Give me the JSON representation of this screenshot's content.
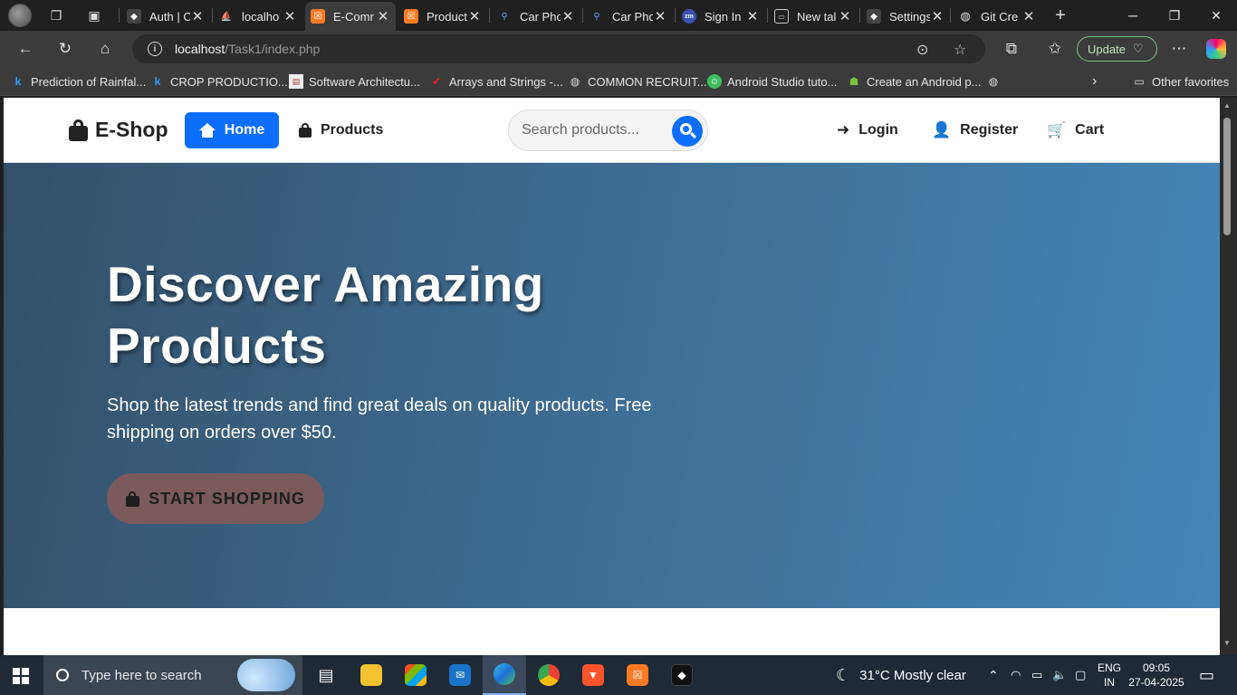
{
  "browser": {
    "tabs": [
      {
        "title": "Auth | C",
        "favicon": "dark-cube-icon",
        "active": false
      },
      {
        "title": "localho",
        "favicon": "pma-sails-icon",
        "active": false
      },
      {
        "title": "E-Comr",
        "favicon": "xampp-icon",
        "active": true
      },
      {
        "title": "Product",
        "favicon": "xampp-icon",
        "active": false
      },
      {
        "title": "Car Pho",
        "favicon": "search-icon",
        "active": false
      },
      {
        "title": "Car Pho",
        "favicon": "search-icon",
        "active": false
      },
      {
        "title": "Sign In |",
        "favicon": "zm-icon",
        "active": false
      },
      {
        "title": "New tal",
        "favicon": "newtab-icon",
        "active": false
      },
      {
        "title": "Settings",
        "favicon": "dark-cube-icon",
        "active": false
      },
      {
        "title": "Git Cre",
        "favicon": "globe-icon",
        "active": false
      }
    ],
    "url_host": "localhost",
    "url_path": "/Task1/index.php",
    "update_label": "Update",
    "favorites": [
      {
        "label": "Prediction of Rainfal...",
        "icon": "k-icon"
      },
      {
        "label": "CROP PRODUCTIO...",
        "icon": "k-icon"
      },
      {
        "label": "Software Architectu...",
        "icon": "doc-icon"
      },
      {
        "label": "Arrays and Strings -...",
        "icon": "red-bird-icon"
      },
      {
        "label": "COMMON RECRUIT...",
        "icon": "globe-icon"
      },
      {
        "label": "Android Studio tuto...",
        "icon": "android-round-icon"
      },
      {
        "label": "Create an Android p...",
        "icon": "android-icon"
      }
    ],
    "other_favorites": "Other favorites"
  },
  "site": {
    "brand": "E-Shop",
    "nav": {
      "home": "Home",
      "products": "Products",
      "login": "Login",
      "register": "Register",
      "cart": "Cart"
    },
    "search": {
      "placeholder": "Search products..."
    },
    "hero": {
      "title": "Discover Amazing Products",
      "subtitle": "Shop the latest trends and find great deals on quality products. Free shipping on orders over $50.",
      "cta": "START SHOPPING"
    },
    "colors": {
      "primary": "#0d6efd",
      "cta_bg": "#7a5a5c",
      "hero_start": "#34506a",
      "hero_end": "#4586b8"
    }
  },
  "taskbar": {
    "search_placeholder": "Type here to search",
    "weather": "31°C  Mostly clear",
    "lang_top": "ENG",
    "lang_bottom": "IN",
    "time": "09:05",
    "date": "27-04-2025"
  }
}
